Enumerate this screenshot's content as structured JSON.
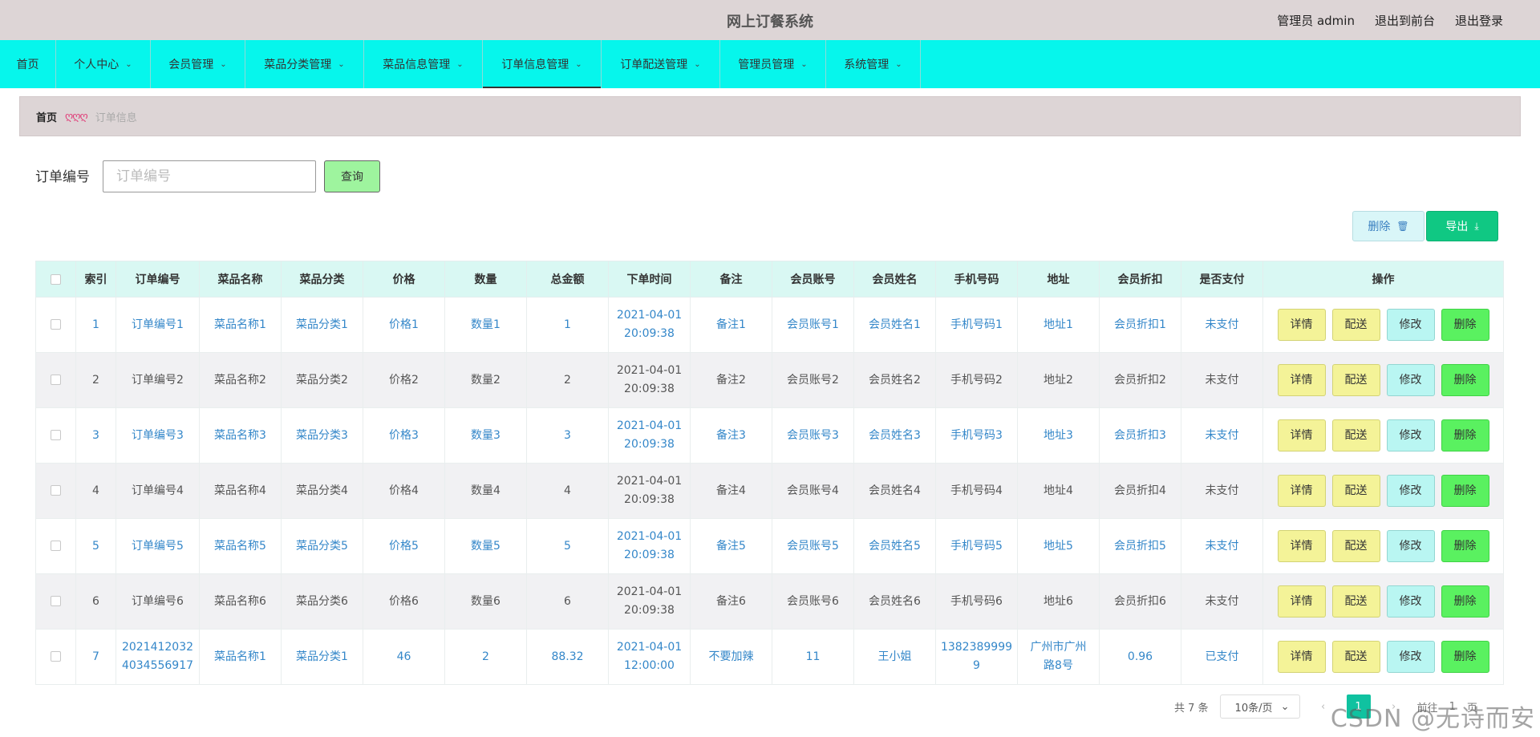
{
  "header": {
    "title": "网上订餐系统",
    "admin_label": "管理员 admin",
    "front_label": "退出到前台",
    "logout_label": "退出登录"
  },
  "nav": [
    {
      "label": "首页",
      "has_arrow": false,
      "active": false
    },
    {
      "label": "个人中心",
      "has_arrow": true,
      "active": false
    },
    {
      "label": "会员管理",
      "has_arrow": true,
      "active": false
    },
    {
      "label": "菜品分类管理",
      "has_arrow": true,
      "active": false
    },
    {
      "label": "菜品信息管理",
      "has_arrow": true,
      "active": false
    },
    {
      "label": "订单信息管理",
      "has_arrow": true,
      "active": true
    },
    {
      "label": "订单配送管理",
      "has_arrow": true,
      "active": false
    },
    {
      "label": "管理员管理",
      "has_arrow": true,
      "active": false
    },
    {
      "label": "系统管理",
      "has_arrow": true,
      "active": false
    }
  ],
  "breadcrumb": {
    "home": "首页",
    "separator": "ღღღ",
    "current": "订单信息"
  },
  "search": {
    "label": "订单编号",
    "placeholder": "订单编号",
    "value": "",
    "button": "查询"
  },
  "actions": {
    "delete_label": "删除",
    "export_label": "导出"
  },
  "table": {
    "headers": [
      "",
      "索引",
      "订单编号",
      "菜品名称",
      "菜品分类",
      "价格",
      "数量",
      "总金额",
      "下单时间",
      "备注",
      "会员账号",
      "会员姓名",
      "手机号码",
      "地址",
      "会员折扣",
      "是否支付",
      "操作"
    ],
    "rows": [
      [
        "1",
        "订单编号1",
        "菜品名称1",
        "菜品分类1",
        "价格1",
        "数量1",
        "1",
        "2021-04-01\n20:09:38",
        "备注1",
        "会员账号1",
        "会员姓名1",
        "手机号码1",
        "地址1",
        "会员折扣1",
        "未支付"
      ],
      [
        "2",
        "订单编号2",
        "菜品名称2",
        "菜品分类2",
        "价格2",
        "数量2",
        "2",
        "2021-04-01\n20:09:38",
        "备注2",
        "会员账号2",
        "会员姓名2",
        "手机号码2",
        "地址2",
        "会员折扣2",
        "未支付"
      ],
      [
        "3",
        "订单编号3",
        "菜品名称3",
        "菜品分类3",
        "价格3",
        "数量3",
        "3",
        "2021-04-01\n20:09:38",
        "备注3",
        "会员账号3",
        "会员姓名3",
        "手机号码3",
        "地址3",
        "会员折扣3",
        "未支付"
      ],
      [
        "4",
        "订单编号4",
        "菜品名称4",
        "菜品分类4",
        "价格4",
        "数量4",
        "4",
        "2021-04-01\n20:09:38",
        "备注4",
        "会员账号4",
        "会员姓名4",
        "手机号码4",
        "地址4",
        "会员折扣4",
        "未支付"
      ],
      [
        "5",
        "订单编号5",
        "菜品名称5",
        "菜品分类5",
        "价格5",
        "数量5",
        "5",
        "2021-04-01\n20:09:38",
        "备注5",
        "会员账号5",
        "会员姓名5",
        "手机号码5",
        "地址5",
        "会员折扣5",
        "未支付"
      ],
      [
        "6",
        "订单编号6",
        "菜品名称6",
        "菜品分类6",
        "价格6",
        "数量6",
        "6",
        "2021-04-01\n20:09:38",
        "备注6",
        "会员账号6",
        "会员姓名6",
        "手机号码6",
        "地址6",
        "会员折扣6",
        "未支付"
      ],
      [
        "7",
        "2021412032\n4034556917",
        "菜品名称1",
        "菜品分类1",
        "46",
        "2",
        "88.32",
        "2021-04-01\n12:00:00",
        "不要加辣",
        "11",
        "王小姐",
        "1382389999\n9",
        "广州市广州\n路8号",
        "0.96",
        "已支付"
      ]
    ],
    "row_actions": {
      "detail": "详情",
      "deliver": "配送",
      "edit": "修改",
      "delete": "删除"
    }
  },
  "pagination": {
    "total": "共 7 条",
    "page_size": "10条/页",
    "current_page": "1",
    "goto_prefix": "前往",
    "goto_value": "1",
    "goto_suffix": "页"
  },
  "watermark": "CSDN @无诗而安",
  "colors": {
    "header_bg": "#ddd5d6",
    "nav_bg": "#06f6ec",
    "table_header_bg": "#d9f8f3",
    "link_text": "#3487c9",
    "export_button": "#10c883",
    "detail_button": "#f4f398",
    "edit_button": "#b9f6f2",
    "delete_button": "#5af160"
  },
  "icons": {
    "nav_arrow": "chevron-down-icon",
    "delete": "trash-icon",
    "export": "download-icon"
  }
}
